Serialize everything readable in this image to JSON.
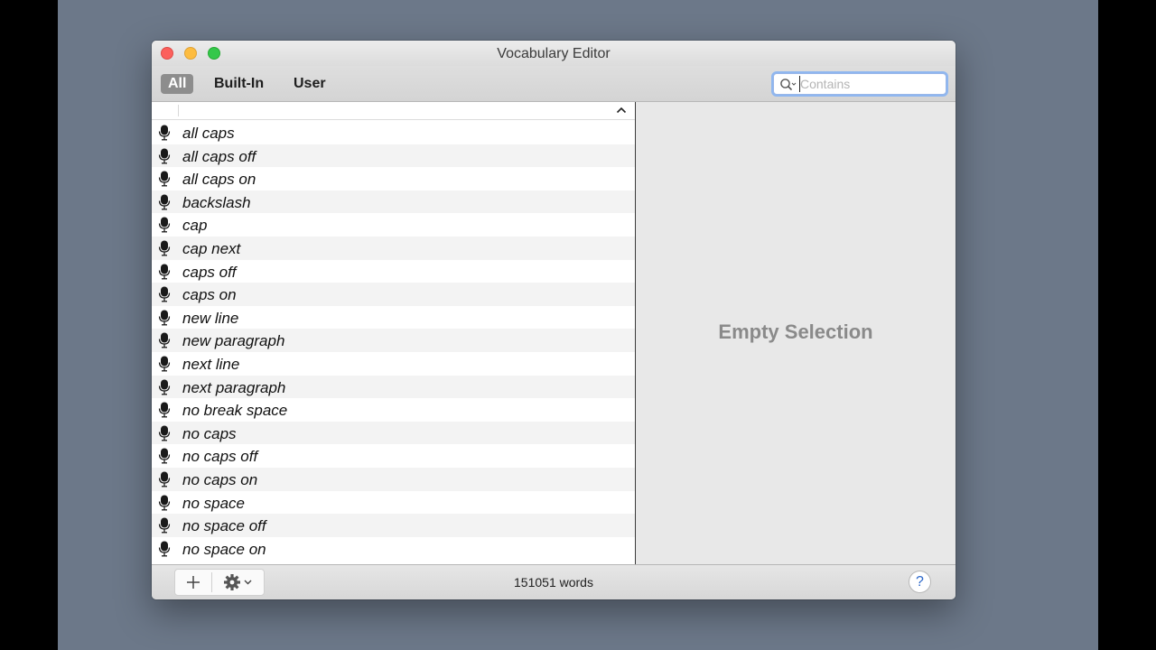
{
  "window": {
    "title": "Vocabulary Editor"
  },
  "toolbar": {
    "scopes": [
      "All",
      "Built-In",
      "User"
    ],
    "active_scope": "All",
    "search": {
      "placeholder": "Contains",
      "value": ""
    }
  },
  "list": {
    "rows": [
      "all caps",
      "all caps off",
      "all caps on",
      "backslash",
      "cap",
      "cap next",
      "caps off",
      "caps on",
      "new line",
      "new paragraph",
      "next line",
      "next paragraph",
      "no break space",
      "no caps",
      "no caps off",
      "no caps on",
      "no space",
      "no space off",
      "no space on"
    ],
    "row_icon": "microphone-icon"
  },
  "detail": {
    "empty_text": "Empty Selection"
  },
  "status": {
    "text": "151051 words"
  },
  "bottombar": {
    "help_label": "?"
  },
  "colors": {
    "accent": "#8fb7f0",
    "scope_active_bg": "#8d8d8d"
  }
}
